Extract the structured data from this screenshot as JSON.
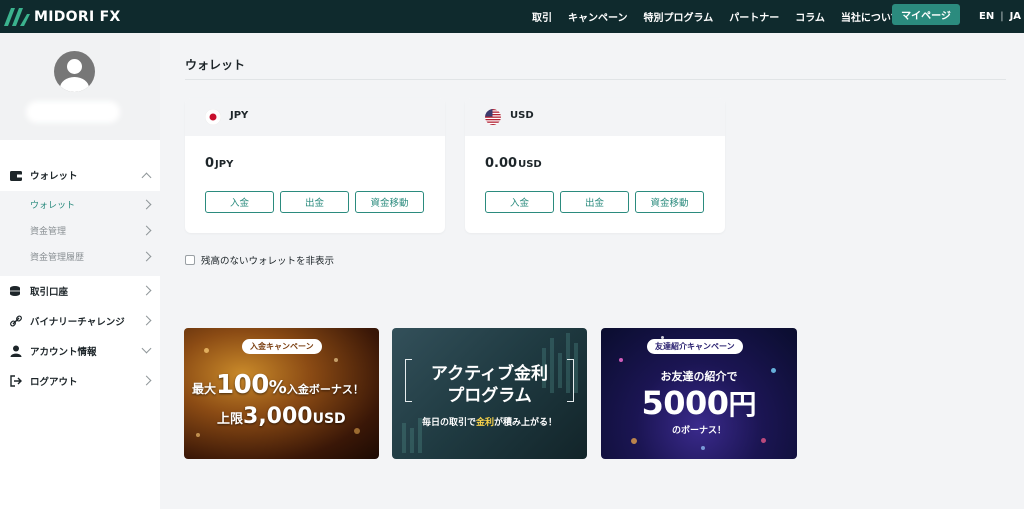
{
  "header": {
    "logo_text": "MIDORI FX",
    "nav": [
      "取引",
      "キャンペーン",
      "特別プログラム",
      "パートナー",
      "コラム",
      "当社について"
    ],
    "mypage_label": "マイページ",
    "lang_en": "EN",
    "lang_separator": "|",
    "lang_ja": "JA"
  },
  "sidebar": {
    "wallet": "ウォレット",
    "wallet_sub": [
      "ウォレット",
      "資金管理",
      "資金管理履歴"
    ],
    "trading_account": "取引口座",
    "binary_challenge": "バイナリーチャレンジ",
    "account_info": "アカウント情報",
    "logout": "ログアウト"
  },
  "main": {
    "title": "ウォレット",
    "wallets": [
      {
        "currency": "JPY",
        "amount": "0",
        "unit": "JPY",
        "flag": "japan-flag-icon"
      },
      {
        "currency": "USD",
        "amount": "0.00",
        "unit": "USD",
        "flag": "us-flag-icon"
      }
    ],
    "buttons": {
      "deposit": "入金",
      "withdraw": "出金",
      "transfer": "資金移動"
    },
    "hide_empty_label": "残高のないウォレットを非表示"
  },
  "banners": {
    "deposit": {
      "badge": "入金キャンペーン",
      "line1_prefix": "最大",
      "line1_big": "100",
      "line1_pct": "%",
      "line1_suffix": "入金ボーナス！",
      "line2_prefix": "上限",
      "line2_big": "3,000",
      "line2_unit": "USD"
    },
    "active": {
      "line1": "アクティブ金利",
      "line2": "プログラム",
      "line3_a": "毎日の取引で",
      "line3_hl": "金利",
      "line3_b": "が積み上がる！"
    },
    "referral": {
      "badge": "友達紹介キャンペーン",
      "line1": "お友達の紹介で",
      "line2_big": "5000",
      "line2_unit": "円",
      "line3": "のボーナス！"
    }
  },
  "colors": {
    "header_bg": "#0f2a2d",
    "accent": "#2b8b7e",
    "brand_green": "#3bb38e"
  }
}
